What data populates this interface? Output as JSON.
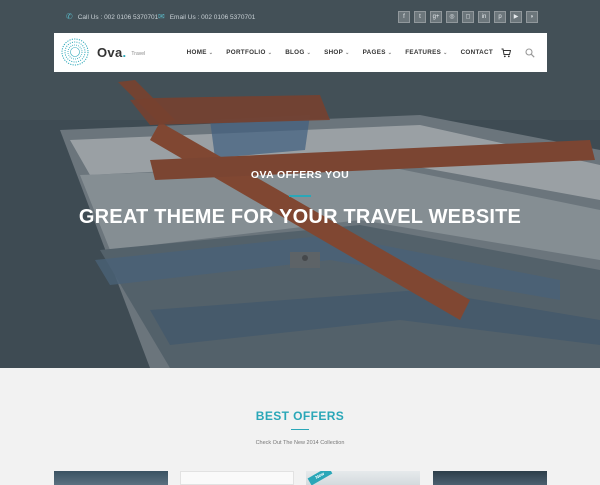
{
  "topbar": {
    "phone": "Call Us : 002 0106 5370701",
    "email": "Email Us : 002 0106 5370701",
    "socials": [
      {
        "icon": "facebook-icon",
        "glyph": "f"
      },
      {
        "icon": "twitter-icon",
        "glyph": "t"
      },
      {
        "icon": "google-plus-icon",
        "glyph": "g+"
      },
      {
        "icon": "dribbble-icon",
        "glyph": "◎"
      },
      {
        "icon": "instagram-icon",
        "glyph": "◻"
      },
      {
        "icon": "linkedin-icon",
        "glyph": "in"
      },
      {
        "icon": "pinterest-icon",
        "glyph": "p"
      },
      {
        "icon": "youtube-icon",
        "glyph": "▶"
      },
      {
        "icon": "rss-icon",
        "glyph": "◗"
      }
    ]
  },
  "nav": {
    "logo_text": "Ova",
    "logo_dot": ".",
    "logo_sub": "Travel",
    "menu": [
      {
        "label": "HOME",
        "dropdown": true
      },
      {
        "label": "PORTFOLIO",
        "dropdown": true
      },
      {
        "label": "BLOG",
        "dropdown": true
      },
      {
        "label": "SHOP",
        "dropdown": true
      },
      {
        "label": "PAGES",
        "dropdown": true
      },
      {
        "label": "FEATURES",
        "dropdown": true
      },
      {
        "label": "CONTACT",
        "dropdown": false
      }
    ],
    "icons": [
      "cart-icon",
      "search-icon"
    ]
  },
  "hero": {
    "kicker": "OVA OFFERS YOU",
    "title": "GREAT THEME FOR YOUR TRAVEL WEBSITE"
  },
  "offers": {
    "title": "BEST OFFERS",
    "subtitle": "Check Out The New 2014 Collection",
    "badge": "New"
  },
  "colors": {
    "accent": "#2aa7b8",
    "nav_bg": "#ffffff",
    "offers_bg": "#f2f2f2"
  }
}
